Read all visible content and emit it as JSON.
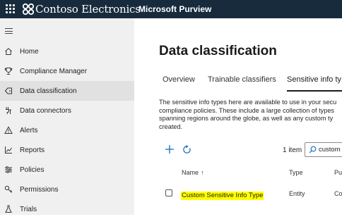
{
  "topbar": {
    "brand": "Contoso Electronics",
    "product": "Microsoft Purview",
    "background": "#172b3c"
  },
  "nav": {
    "toggle_icon": "hamburger-icon",
    "items": [
      {
        "label": "Home",
        "icon": "home-icon"
      },
      {
        "label": "Compliance Manager",
        "icon": "trophy-icon"
      },
      {
        "label": "Data classification",
        "icon": "tag-icon",
        "active": true
      },
      {
        "label": "Data connectors",
        "icon": "connector-icon"
      },
      {
        "label": "Alerts",
        "icon": "warning-icon"
      },
      {
        "label": "Reports",
        "icon": "chart-icon"
      },
      {
        "label": "Policies",
        "icon": "sliders-icon"
      },
      {
        "label": "Permissions",
        "icon": "key-icon"
      },
      {
        "label": "Trials",
        "icon": "flask-icon"
      }
    ]
  },
  "main": {
    "title": "Data classification",
    "tabs": [
      {
        "label": "Overview"
      },
      {
        "label": "Trainable classifiers"
      },
      {
        "label": "Sensitive info ty",
        "selected": true
      }
    ],
    "description_lines": [
      "The sensitive info types here are available to use in your secu",
      "compliance policies. These include a large collection of types",
      "spanning regions around the globe, as well as any custom ty",
      "created."
    ],
    "toolbar": {
      "items_count": "1 item",
      "search_value": "custom",
      "add_icon": "plus-icon",
      "refresh_icon": "refresh-icon"
    },
    "table": {
      "columns": [
        "Name",
        "Type",
        "Pu"
      ],
      "sort_indicator": "↑",
      "rows": [
        {
          "name": "Custom Sensitive Info Type",
          "type": "Entity",
          "publisher": "Co"
        }
      ]
    }
  },
  "colors": {
    "highlight": "#ffff00",
    "accent": "#0f6cbd",
    "nav_background": "#f0f0f0"
  }
}
